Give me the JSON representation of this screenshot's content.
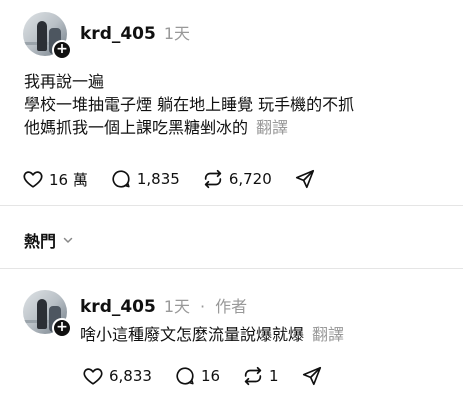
{
  "post": {
    "username": "krd_405",
    "time": "1天",
    "lines": [
      "我再說一遍",
      "學校一堆抽電子煙 躺在地上睡覺 玩手機的不抓",
      "他媽抓我一個上課吃黑糖剉冰的"
    ],
    "translate": "翻譯",
    "likes": "16 萬",
    "comments": "1,835",
    "reposts": "6,720"
  },
  "sort": {
    "label": "熱門"
  },
  "reply": {
    "username": "krd_405",
    "time": "1天",
    "separator": "·",
    "author_tag": "作者",
    "text": "啥小這種廢文怎麼流量說爆就爆",
    "translate": "翻譯",
    "likes": "6,833",
    "comments": "16",
    "reposts": "1"
  },
  "icons": {
    "like": "heart-icon",
    "comment": "comment-bubble-icon",
    "repost": "repost-icon",
    "share": "send-icon",
    "follow": "plus-icon",
    "sort": "chevron-down-icon"
  }
}
